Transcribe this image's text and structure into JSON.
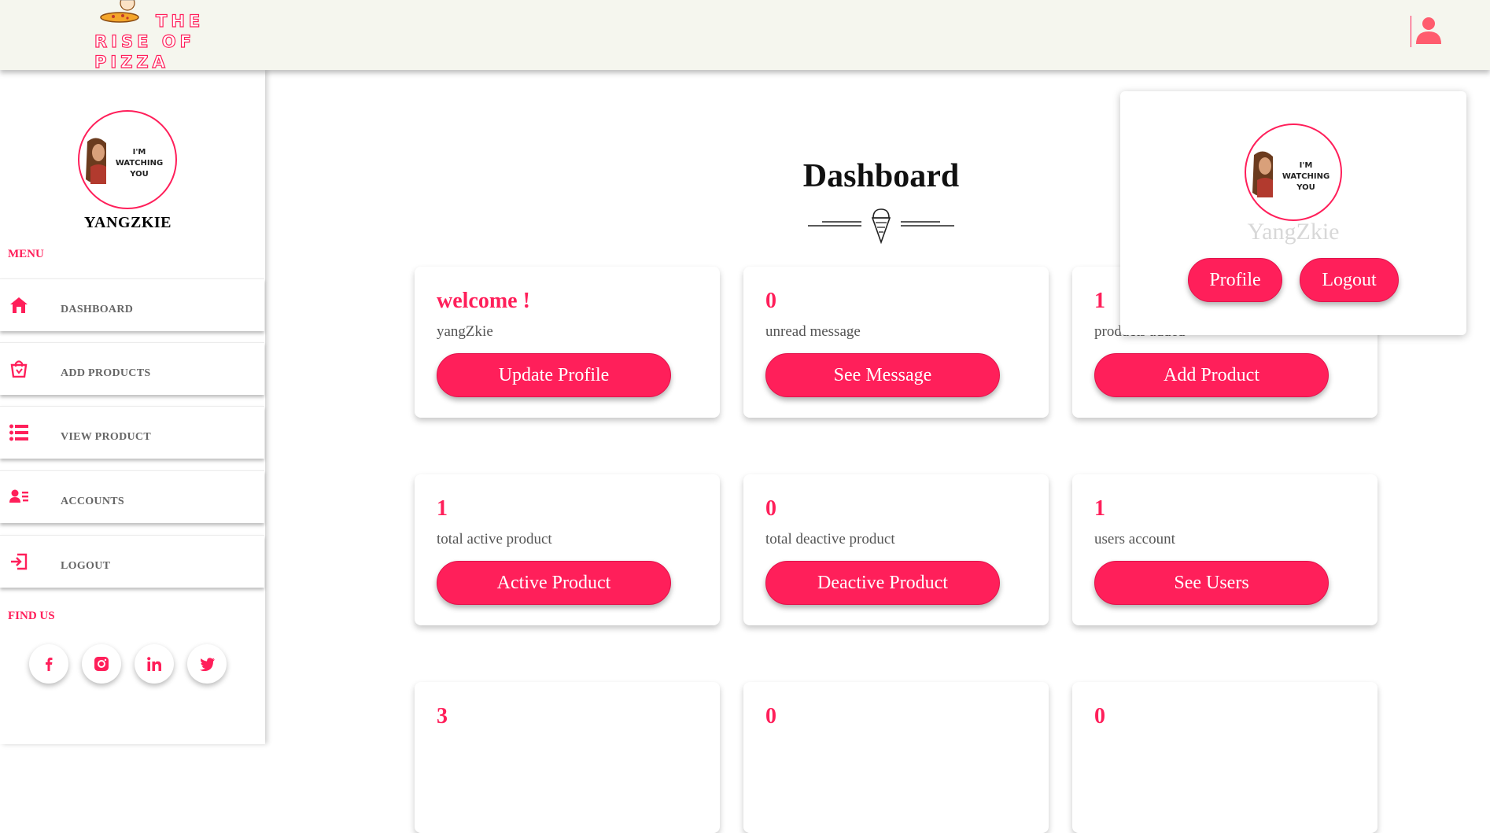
{
  "header": {
    "logo_line1": "THE",
    "logo_line2": "RISE OF PIZZA",
    "user_icon": "user-icon"
  },
  "sidebar": {
    "avatar_text": "I'M WATCHING YOU",
    "username": "YANGZKIE",
    "menu_label": "MENU",
    "items": [
      {
        "label": "DASHBOARD",
        "icon": "home-icon"
      },
      {
        "label": "ADD PRODUCTS",
        "icon": "shopping-bag-icon"
      },
      {
        "label": "VIEW PRODUCT",
        "icon": "list-icon"
      },
      {
        "label": "ACCOUNTS",
        "icon": "user-list-icon"
      },
      {
        "label": "LOGOUT",
        "icon": "logout-icon"
      }
    ],
    "find_us_label": "FIND US",
    "social": [
      "facebook-icon",
      "instagram-icon",
      "linkedin-icon",
      "twitter-icon"
    ]
  },
  "main": {
    "title": "Dashboard",
    "cards": [
      {
        "num": "welcome !",
        "sub": "yangZkie",
        "button": "Update Profile"
      },
      {
        "num": "0",
        "sub": "unread message",
        "button": "See Message"
      },
      {
        "num": "1",
        "sub": "products added",
        "button": "Add Product"
      },
      {
        "num": "1",
        "sub": "total active product",
        "button": "Active Product"
      },
      {
        "num": "0",
        "sub": "total deactive product",
        "button": "Deactive Product"
      },
      {
        "num": "1",
        "sub": "users account",
        "button": "See Users"
      },
      {
        "num": "3",
        "sub": "",
        "button": ""
      },
      {
        "num": "0",
        "sub": "",
        "button": ""
      },
      {
        "num": "0",
        "sub": "",
        "button": ""
      }
    ]
  },
  "popup": {
    "avatar_text": "I'M WATCHING YOU",
    "name": "YangZkie",
    "profile_button": "Profile",
    "logout_button": "Logout"
  },
  "colors": {
    "accent": "#ff1f5a",
    "header_bg": "#f5f6ee"
  }
}
